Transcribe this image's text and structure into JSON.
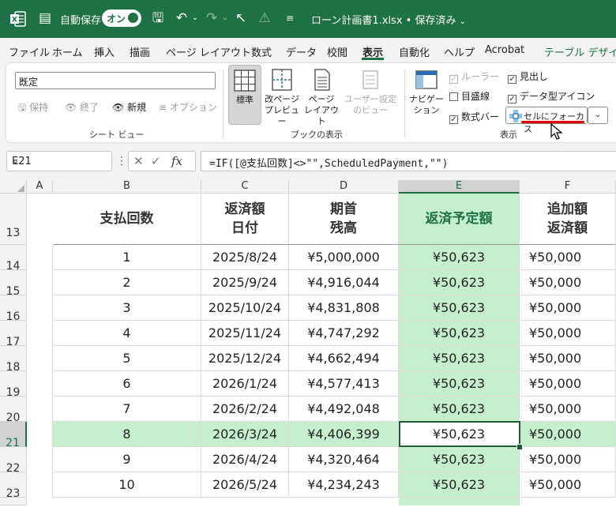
{
  "titlebar": {
    "autosave_label": "自動保存",
    "toggle_label": "オン",
    "file_title": "ローン計画書1.xlsx • 保存済み"
  },
  "menu": {
    "tabs": [
      "ファイル",
      "ホーム",
      "挿入",
      "描画",
      "ページ レイアウト",
      "数式",
      "データ",
      "校閲",
      "表示",
      "自動化",
      "ヘルプ",
      "Acrobat",
      "テーブル デザイン"
    ],
    "active_index": 8
  },
  "ribbon": {
    "sheet_view": {
      "combo_value": "既定",
      "keep": "保持",
      "exit": "終了",
      "new": "新規",
      "options": "オプション",
      "group_label": "シート ビュー"
    },
    "workbook_views": {
      "normal": "標準",
      "page_break_1": "改ページ",
      "page_break_2": "プレビュー",
      "page_layout_1": "ページ",
      "page_layout_2": "レイアウト",
      "custom_1": "ユーザー設定",
      "custom_2": "のビュー",
      "group_label": "ブックの表示"
    },
    "show": {
      "navigation_1": "ナビゲー",
      "navigation_2": "ション",
      "ruler": "ルーラー",
      "headings": "見出し",
      "gridlines": "目盛線",
      "data_type_icons": "データ型アイコン",
      "formula_bar": "数式バー",
      "focus_cell": "セルにフォーカス",
      "group_label": "表示"
    }
  },
  "formula_bar": {
    "name_box": "E21",
    "formula": "=IF([@支払回数]<>\"\",ScheduledPayment,\"\")"
  },
  "grid": {
    "columns": [
      "A",
      "B",
      "C",
      "D",
      "E",
      "F"
    ],
    "header_row": "13",
    "headers": {
      "b": "支払回数",
      "c1": "返済額",
      "c2": "日付",
      "d1": "期首",
      "d2": "残高",
      "e": "返済予定額",
      "f1": "追加額",
      "f2": "返済額"
    },
    "rows": [
      {
        "row": "14",
        "no": "1",
        "date": "2025/8/24",
        "balance": "¥5,000,000",
        "payment": "¥50,623",
        "extra": "¥50,000"
      },
      {
        "row": "15",
        "no": "2",
        "date": "2025/9/24",
        "balance": "¥4,916,044",
        "payment": "¥50,623",
        "extra": "¥50,000"
      },
      {
        "row": "16",
        "no": "3",
        "date": "2025/10/24",
        "balance": "¥4,831,808",
        "payment": "¥50,623",
        "extra": "¥50,000"
      },
      {
        "row": "17",
        "no": "4",
        "date": "2025/11/24",
        "balance": "¥4,747,292",
        "payment": "¥50,623",
        "extra": "¥50,000"
      },
      {
        "row": "18",
        "no": "5",
        "date": "2025/12/24",
        "balance": "¥4,662,494",
        "payment": "¥50,623",
        "extra": "¥50,000"
      },
      {
        "row": "19",
        "no": "6",
        "date": "2026/1/24",
        "balance": "¥4,577,413",
        "payment": "¥50,623",
        "extra": "¥50,000"
      },
      {
        "row": "20",
        "no": "7",
        "date": "2026/2/24",
        "balance": "¥4,492,048",
        "payment": "¥50,623",
        "extra": "¥50,000"
      },
      {
        "row": "21",
        "no": "8",
        "date": "2026/3/24",
        "balance": "¥4,406,399",
        "payment": "¥50,623",
        "extra": "¥50,000"
      },
      {
        "row": "22",
        "no": "9",
        "date": "2026/4/24",
        "balance": "¥4,320,464",
        "payment": "¥50,623",
        "extra": "¥50,000"
      },
      {
        "row": "23",
        "no": "10",
        "date": "2026/5/24",
        "balance": "¥4,234,243",
        "payment": "¥50,623",
        "extra": "¥50,000"
      }
    ],
    "selected_row": "21",
    "selected_column": "E"
  },
  "colors": {
    "accent": "#1e7145",
    "selected_column_fill": "#c6efce",
    "selected_row_fill": "#c6efce",
    "focus_underline": "#e00000"
  }
}
